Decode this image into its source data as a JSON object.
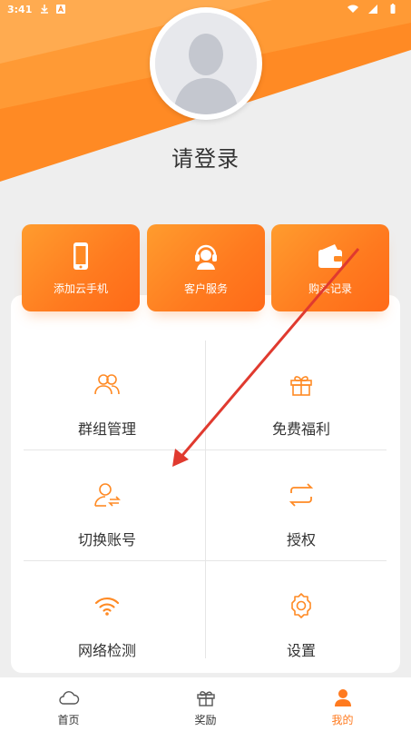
{
  "status_bar": {
    "time": "3:41",
    "icons_left": [
      "download-icon",
      "a-icon"
    ],
    "icons_right": [
      "wifi-icon",
      "signal-icon",
      "battery-icon"
    ]
  },
  "profile": {
    "login_text": "请登录",
    "avatar_icon": "default-avatar-icon"
  },
  "quick_actions": [
    {
      "label": "添加云手机",
      "icon": "phone-icon"
    },
    {
      "label": "客户服务",
      "icon": "headset-icon"
    },
    {
      "label": "购买记录",
      "icon": "wallet-icon"
    }
  ],
  "menu": [
    {
      "label": "群组管理",
      "icon": "group-icon"
    },
    {
      "label": "免费福利",
      "icon": "gift-icon"
    },
    {
      "label": "切换账号",
      "icon": "switch-user-icon"
    },
    {
      "label": "授权",
      "icon": "swap-icon"
    },
    {
      "label": "网络检测",
      "icon": "wifi-icon"
    },
    {
      "label": "设置",
      "icon": "gear-icon"
    }
  ],
  "tabbar": [
    {
      "label": "首页",
      "icon": "cloud-icon",
      "active": false
    },
    {
      "label": "奖励",
      "icon": "gift-icon",
      "active": false
    },
    {
      "label": "我的",
      "icon": "person-icon",
      "active": true
    }
  ],
  "colors": {
    "accent": "#ff7a1f",
    "accent_light": "#ff9c2e",
    "background": "#eeeeee",
    "annotation_arrow": "#e03a2f"
  }
}
